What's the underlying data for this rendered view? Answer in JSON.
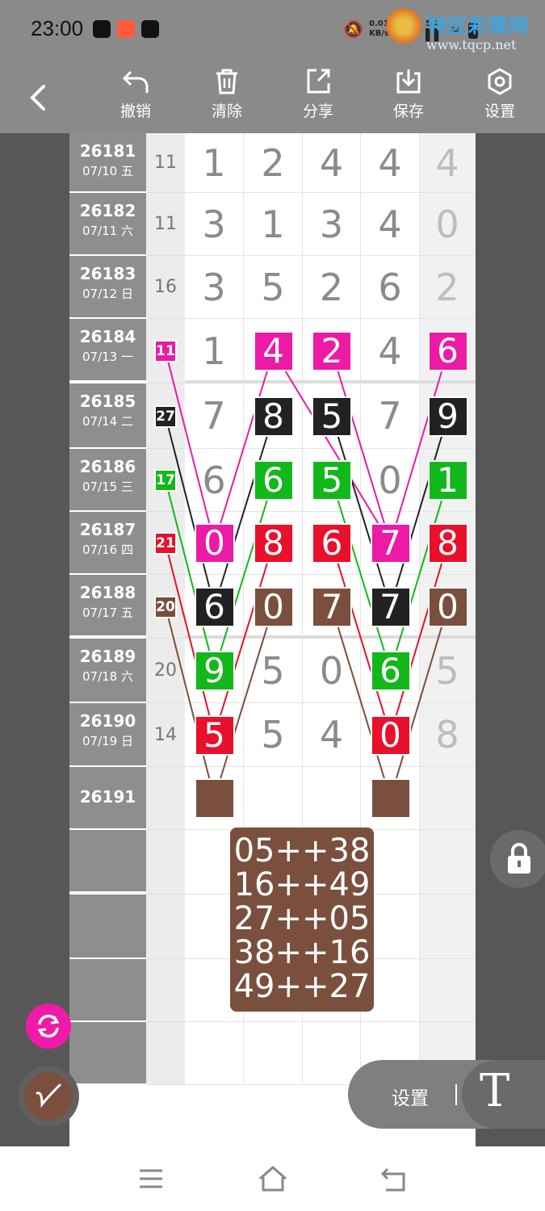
{
  "status_bar": {
    "time": "23:00",
    "net_speed": "0.01 KB/s",
    "signal": "5G"
  },
  "watermark": {
    "title": "特区彩票网",
    "url": "www.tqcp.net"
  },
  "toolbar": {
    "undo_label": "撤销",
    "clear_label": "清除",
    "share_label": "分享",
    "save_label": "保存",
    "settings_label": "设置"
  },
  "rows": [
    {
      "id": "26181",
      "date": "07/10 五",
      "sum": "11",
      "digits": [
        "1",
        "2",
        "4",
        "4"
      ],
      "extra": "4"
    },
    {
      "id": "26182",
      "date": "07/11 六",
      "sum": "11",
      "digits": [
        "3",
        "1",
        "3",
        "4"
      ],
      "extra": "0"
    },
    {
      "id": "26183",
      "date": "07/12 日",
      "sum": "16",
      "digits": [
        "3",
        "5",
        "2",
        "6"
      ],
      "extra": "2"
    },
    {
      "id": "26184",
      "date": "07/13 一",
      "sum": "11",
      "digits": [
        "1",
        "4",
        "2",
        "4"
      ],
      "extra": "6"
    },
    {
      "id": "26185",
      "date": "07/14 二",
      "sum": "27",
      "digits": [
        "7",
        "8",
        "5",
        "7"
      ],
      "extra": "9"
    },
    {
      "id": "26186",
      "date": "07/15 三",
      "sum": "17",
      "digits": [
        "6",
        "6",
        "5",
        "0"
      ],
      "extra": "1"
    },
    {
      "id": "26187",
      "date": "07/16 四",
      "sum": "21",
      "digits": [
        "0",
        "8",
        "6",
        "7"
      ],
      "extra": "8"
    },
    {
      "id": "26188",
      "date": "07/17 五",
      "sum": "20",
      "digits": [
        "6",
        "0",
        "7",
        "7"
      ],
      "extra": "0"
    },
    {
      "id": "26189",
      "date": "07/18 六",
      "sum": "20",
      "digits": [
        "9",
        "5",
        "0",
        "6"
      ],
      "extra": "5"
    },
    {
      "id": "26190",
      "date": "07/19 日",
      "sum": "14",
      "digits": [
        "5",
        "5",
        "4",
        "0"
      ],
      "extra": "8"
    },
    {
      "id": "26191",
      "date": "",
      "sum": "",
      "digits": [
        "",
        "",
        "",
        ""
      ],
      "extra": ""
    }
  ],
  "highlights": [
    {
      "row": 3,
      "col": "sum",
      "color": "#ec1aa5"
    },
    {
      "row": 3,
      "col": 1,
      "color": "#ec1aa5"
    },
    {
      "row": 3,
      "col": 2,
      "color": "#ec1aa5"
    },
    {
      "row": 3,
      "col": 4,
      "color": "#ec1aa5"
    },
    {
      "row": 4,
      "col": "sum",
      "color": "#222222"
    },
    {
      "row": 4,
      "col": 1,
      "color": "#222222"
    },
    {
      "row": 4,
      "col": 2,
      "color": "#222222"
    },
    {
      "row": 4,
      "col": 4,
      "color": "#222222"
    },
    {
      "row": 5,
      "col": "sum",
      "color": "#12b81a"
    },
    {
      "row": 5,
      "col": 1,
      "color": "#12b81a"
    },
    {
      "row": 5,
      "col": 2,
      "color": "#12b81a"
    },
    {
      "row": 5,
      "col": 4,
      "color": "#12b81a"
    },
    {
      "row": 6,
      "col": "sum",
      "color": "#e8102a"
    },
    {
      "row": 6,
      "col": 0,
      "color": "#ec1aa5"
    },
    {
      "row": 6,
      "col": 1,
      "color": "#e8102a"
    },
    {
      "row": 6,
      "col": 2,
      "color": "#e8102a"
    },
    {
      "row": 6,
      "col": 3,
      "color": "#ec1aa5"
    },
    {
      "row": 6,
      "col": 4,
      "color": "#e8102a"
    },
    {
      "row": 7,
      "col": "sum",
      "color": "#7a4f3d"
    },
    {
      "row": 7,
      "col": 0,
      "color": "#222222"
    },
    {
      "row": 7,
      "col": 1,
      "color": "#7a4f3d"
    },
    {
      "row": 7,
      "col": 2,
      "color": "#7a4f3d"
    },
    {
      "row": 7,
      "col": 3,
      "color": "#222222"
    },
    {
      "row": 7,
      "col": 4,
      "color": "#7a4f3d"
    },
    {
      "row": 8,
      "col": 0,
      "color": "#12b81a"
    },
    {
      "row": 8,
      "col": 3,
      "color": "#12b81a"
    },
    {
      "row": 9,
      "col": 0,
      "color": "#e8102a"
    },
    {
      "row": 9,
      "col": 3,
      "color": "#e8102a"
    },
    {
      "row": 10,
      "col": 0,
      "color": "#7a4f3d"
    },
    {
      "row": 10,
      "col": 3,
      "color": "#7a4f3d"
    }
  ],
  "formula_lines": [
    "05++38",
    "16++49",
    "27++05",
    "38++16",
    "49++27"
  ],
  "bottom_panel": {
    "settings_label": "设置",
    "text_tool_glyph": "T"
  },
  "colors": {
    "magenta": "#ec1aa5",
    "black": "#222222",
    "green": "#12b81a",
    "red": "#e8102a",
    "brown": "#7a4f3d"
  }
}
